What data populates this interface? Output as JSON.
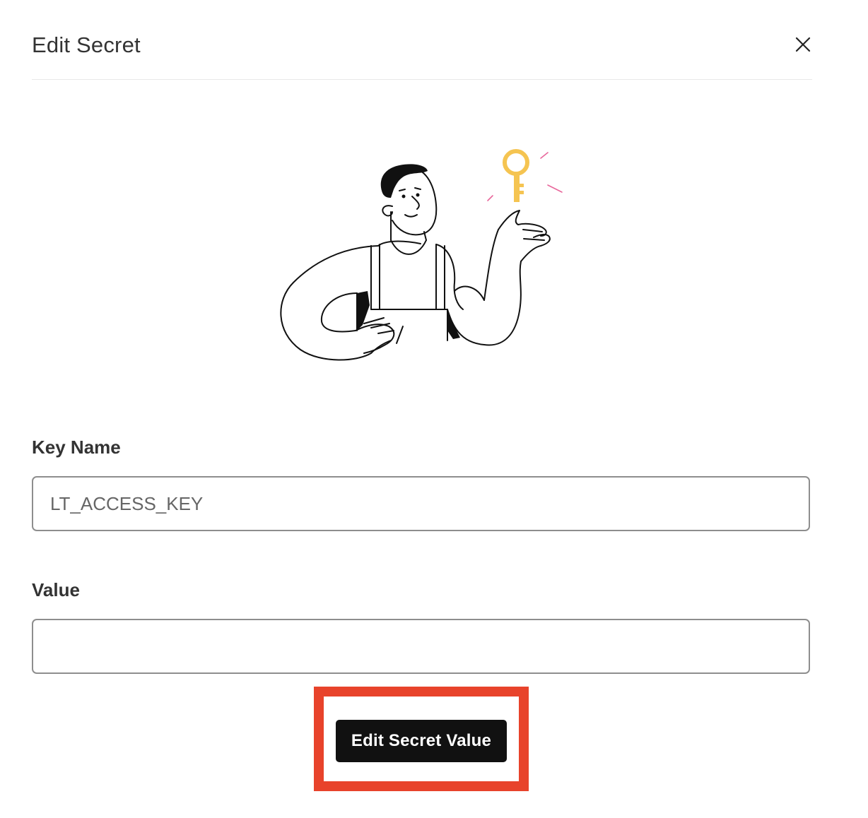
{
  "dialog": {
    "title": "Edit Secret",
    "close_icon": "close-icon"
  },
  "illustration": {
    "icon": "person-holding-key-illustration",
    "key_color": "#f5c451",
    "spark_color": "#e8689c"
  },
  "form": {
    "key_name": {
      "label": "Key Name",
      "value": "LT_ACCESS_KEY"
    },
    "value": {
      "label": "Value",
      "value": ""
    }
  },
  "actions": {
    "edit_button_label": "Edit Secret Value",
    "highlight_color": "#e8432b"
  }
}
